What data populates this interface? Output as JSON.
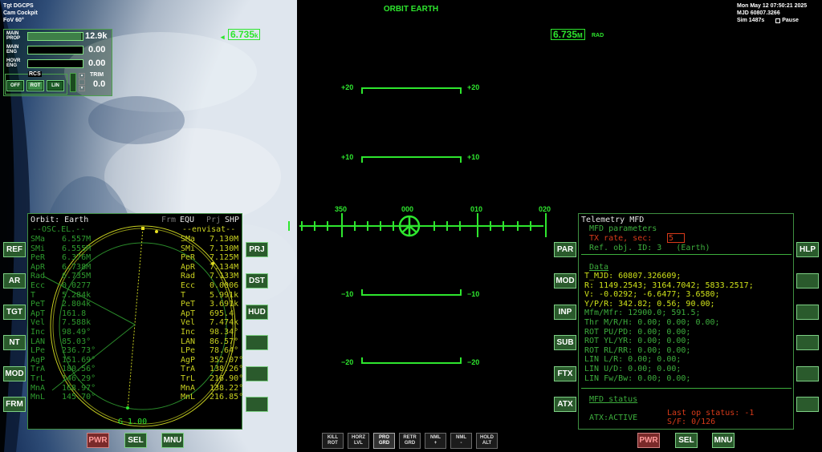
{
  "top_left": {
    "tgt": "Tgt   DGCPS",
    "cam": "Cam Cockpit",
    "fov": "FoV  60°"
  },
  "top_center": {
    "title": "ORBIT EARTH"
  },
  "top_right": {
    "date": "Mon May 12 07:50:21 2025",
    "mjd": "MJD  60807.3266",
    "sim": "Sim   1487s",
    "pause": "Pause"
  },
  "hud": {
    "left_value": "6.735",
    "left_unit": "k",
    "right_value": "6.735",
    "right_unit": "M",
    "right_suffix": "RAD",
    "pitch_labels": [
      "+20",
      "+20",
      "+10",
      "+10",
      "−10",
      "−10",
      "−20",
      "−20"
    ],
    "heading_labels": [
      "350",
      "000",
      "010",
      "020"
    ]
  },
  "engines": {
    "main_label": "MAIN\nPROP",
    "main_value": "12.9k",
    "eng_label": "MAIN\nENG",
    "eng_value": "0.00",
    "hovr_label": "HOVR\nENG",
    "hovr_value": "0.00",
    "main_prop_level": 0.97
  },
  "rcs": {
    "label": "RCS",
    "off": "OFF",
    "rot": "ROT",
    "lin": "LIN",
    "trim_label": "TRIM",
    "trim_value": "0.0"
  },
  "left_mfd": {
    "title": "Orbit: Earth",
    "frm": "Frm",
    "equ": "EQU",
    "prj": "Prj",
    "shp": "SHP",
    "left_header": "--OSC.EL.--",
    "right_header": "--envisat--",
    "rows": [
      [
        "SMa",
        "6.557M",
        "SMa",
        "7.130M"
      ],
      [
        "SMi",
        "6.555M",
        "SMi",
        "7.130M"
      ],
      [
        "PeR",
        "6.376M",
        "PeR",
        "7.125M"
      ],
      [
        "ApR",
        "6.738M",
        "ApR",
        "7.134M"
      ],
      [
        "Rad",
        "6.735M",
        "Rad",
        "7.133M"
      ],
      [
        "Ecc",
        "0.0277",
        "Ecc",
        "0.0006"
      ],
      [
        "T",
        "5.284k",
        "T",
        "5.991k"
      ],
      [
        "PeT",
        "2.804k",
        "PeT",
        "3.691k"
      ],
      [
        "ApT",
        "161.8",
        "ApT",
        "695.4"
      ],
      [
        "Vel",
        "7.588k",
        "Vel",
        "7.474k"
      ],
      [
        "Inc",
        "98.49°",
        "Inc",
        "98.34°"
      ],
      [
        "LAN",
        "85.03°",
        "LAN",
        "86.57°"
      ],
      [
        "LPe",
        "236.73°",
        "LPe",
        "78.64°"
      ],
      [
        "AgP",
        "151.69°",
        "AgP",
        "352.07°"
      ],
      [
        "TrA",
        "180.56°",
        "TrA",
        "138.26°"
      ],
      [
        "TrL",
        "146.29°",
        "TrL",
        "216.90°"
      ],
      [
        "MnA",
        "168.97°",
        "MnA",
        "138.22°"
      ],
      [
        "MnL",
        "145.70°",
        "MnL",
        "216.85°"
      ]
    ],
    "footer": "G 1.00",
    "buttons_left": [
      "REF",
      "AR",
      "TGT",
      "NT",
      "MOD",
      "FRM"
    ],
    "buttons_right": [
      "PRJ",
      "DST",
      "HUD",
      "",
      "",
      ""
    ],
    "bottom": [
      "PWR",
      "SEL",
      "MNU"
    ]
  },
  "right_mfd": {
    "title": "Telemetry MFD",
    "params_header": "MFD parameters",
    "tx_label": "TX rate, sec:",
    "tx_value": "5",
    "ref_line": "Ref. obj. ID: 3   (Earth)",
    "data_header": "Data",
    "data": [
      "T_MJD: 60807.326609;",
      "R: 1149.2543; 3164.7042; 5833.2517;",
      "V: -0.0292; -6.6477; 3.6580;",
      "Y/P/R: 342.82; 0.56; 90.00;",
      "Mfm/Mfr: 12900.0; 591.5;",
      "Thr M/R/H: 0.00; 0.00; 0.00;",
      "ROT PU/PD: 0.00; 0.00;",
      "ROT YL/YR: 0.00; 0.00;",
      "ROT RL/RR: 0.00; 0.00;",
      "LIN L/R: 0.00; 0.00;",
      "LIN U/D: 0.00; 0.00;",
      "LIN Fw/Bw: 0.00; 0.00;"
    ],
    "status_header": "MFD status",
    "active": "ATX:ACTIVE",
    "last_op": "Last op status: -1",
    "sf": "S/F: 0/126",
    "buttons_left": [
      "PAR",
      "MOD",
      "INP",
      "SUB",
      "FTX",
      "ATX"
    ],
    "buttons_right": [
      "HLP",
      "",
      "",
      "",
      "",
      ""
    ],
    "bottom": [
      "PWR",
      "SEL",
      "MNU"
    ]
  },
  "autopilot": [
    [
      "KILL",
      "ROT"
    ],
    [
      "HORZ",
      "LVL"
    ],
    [
      "PRO",
      "GRD"
    ],
    [
      "RETR",
      "GRD"
    ],
    [
      "NML",
      "+"
    ],
    [
      "NML",
      "-"
    ],
    [
      "HOLD",
      "ALT"
    ]
  ],
  "colors": {
    "hud": "#2ee62e",
    "mfd_text": "#cfe21a",
    "mfd_dim": "#3dae3d",
    "mfd_red": "#d83a1a"
  }
}
